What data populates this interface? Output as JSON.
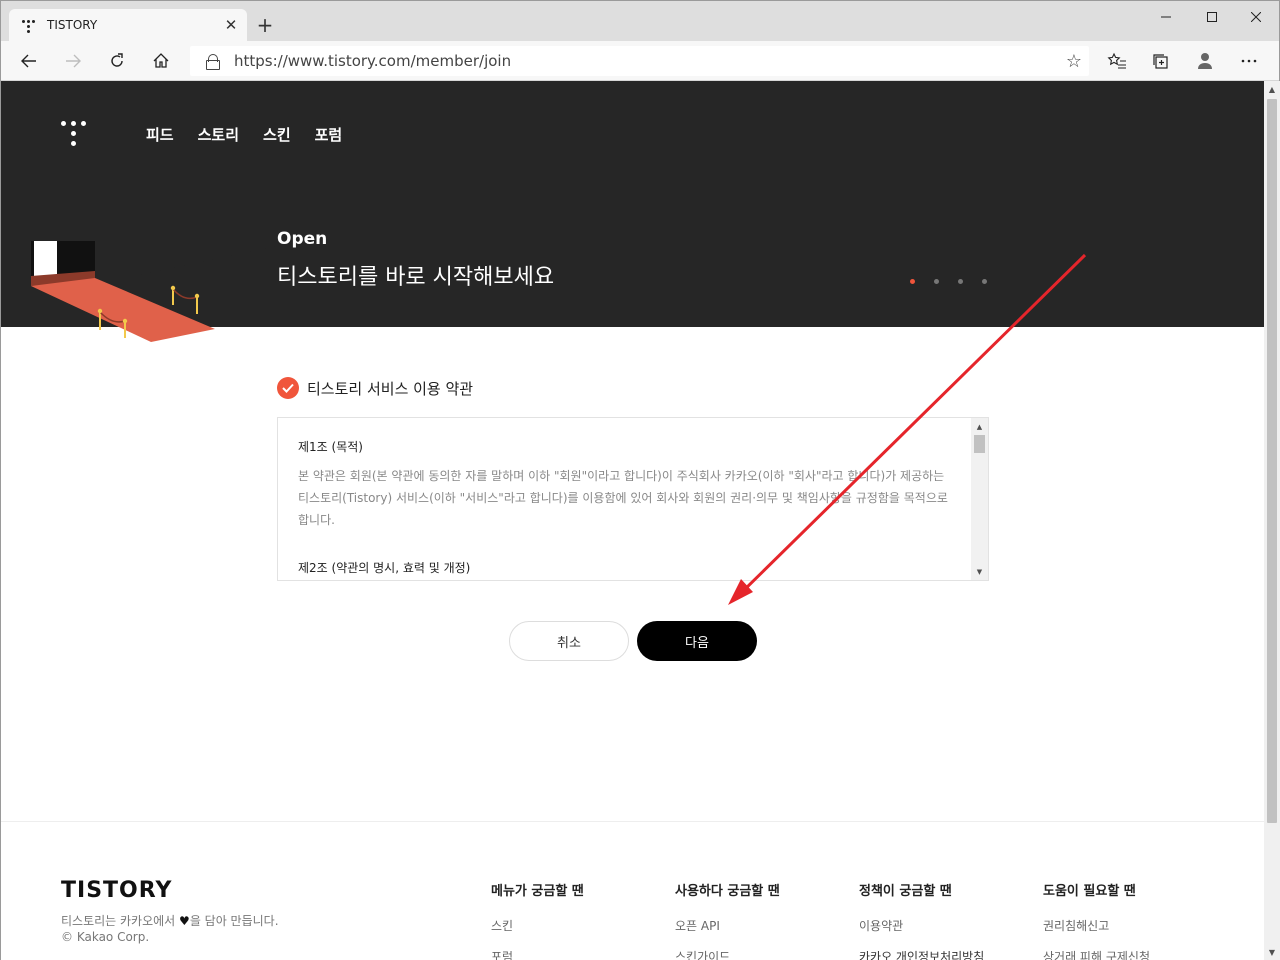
{
  "browser": {
    "tab_title": "TISTORY",
    "tab_close": "✕",
    "new_tab": "+",
    "url": "https://www.tistory.com/member/join"
  },
  "nav": {
    "items": [
      "피드",
      "스토리",
      "스킨",
      "포럼"
    ]
  },
  "hero": {
    "subtitle": "Open",
    "title": "티스토리를 바로 시작해보세요",
    "slide_count": 4,
    "active_slide": 0
  },
  "terms": {
    "label": "티스토리 서비스 이용 약관",
    "article1_title": "제1조 (목적)",
    "article1_text": "본 약관은 회원(본 약관에 동의한 자를 말하며 이하 \"회원\"이라고 합니다)이 주식회사 카카오(이하 \"회사\"라고 합니다)가 제공하는 티스토리(Tistory) 서비스(이하 \"서비스\"라고 합니다)를 이용함에 있어 회사와 회원의 권리·의무 및 책임사항을 규정함을 목적으로 합니다.",
    "article2_title": "제2조 (약관의 명시, 효력 및 개정)"
  },
  "buttons": {
    "cancel": "취소",
    "next": "다음"
  },
  "footer": {
    "brand": "TISTORY",
    "tagline_before": "티스토리는 카카오에서",
    "tagline_after": "을 담아 만듭니다.",
    "copyright": "© Kakao Corp.",
    "columns": [
      {
        "title": "메뉴가 궁금할 땐",
        "links": [
          "스킨",
          "포럼"
        ]
      },
      {
        "title": "사용하다 궁금할 땐",
        "links": [
          "오픈 API",
          "스킨가이드"
        ]
      },
      {
        "title": "정책이 궁금할 땐",
        "links": [
          "이용약관",
          "카카오 개인정보처리방침"
        ]
      },
      {
        "title": "도움이 필요할 땐",
        "links": [
          "권리침해신고",
          "상거래 피해 구제신청"
        ]
      }
    ]
  },
  "colors": {
    "accent": "#f0553b",
    "hero_bg": "#262626",
    "annotation_arrow": "#e5252b"
  }
}
